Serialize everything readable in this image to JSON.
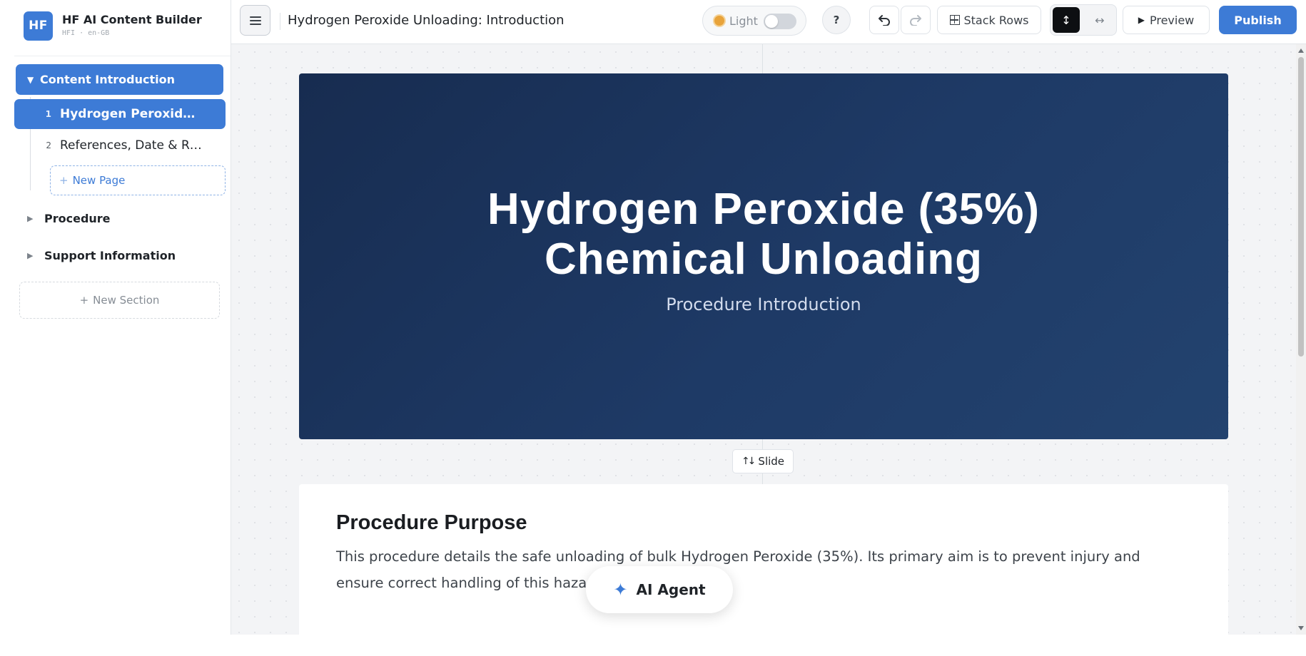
{
  "brand": {
    "logo_text": "HF",
    "title": "HF AI Content Builder",
    "subtitle": "HFI · en-GB",
    "accent_color": "#3d7bd6"
  },
  "sidebar": {
    "sections": [
      {
        "label": "Content Introduction",
        "expanded": true,
        "active": true,
        "pages": [
          {
            "number": "1",
            "label": "Hydrogen Peroxide ...",
            "active": true
          },
          {
            "number": "2",
            "label": "References, Date & Ri...",
            "active": false
          }
        ]
      },
      {
        "label": "Procedure",
        "expanded": false
      },
      {
        "label": "Support Information",
        "expanded": false
      }
    ],
    "new_page_label": "New Page",
    "new_section_label": "New Section",
    "icons": {
      "expanded": "caret-down-icon",
      "collapsed": "caret-right-icon",
      "add": "plus-icon"
    }
  },
  "toolbar": {
    "menu_icon": "hamburger-menu-icon",
    "document_title": "Hydrogen Peroxide Unloading: Introduction",
    "theme_label": "Light",
    "theme_dark_enabled": false,
    "help_label": "?",
    "undo_icon": "undo-icon",
    "redo_icon": "redo-icon",
    "stack_rows_label": "Stack Rows",
    "layout_mode": "vertical",
    "preview_label": "Preview",
    "publish_label": "Publish"
  },
  "canvas": {
    "title_slide": {
      "title": "Hydrogen Peroxide (35%)\nChemical Unloading",
      "subtitle": "Procedure Introduction",
      "background_color": "#1e3a66"
    },
    "slide_chip_label": "Slide",
    "content_block": {
      "heading": "Procedure Purpose",
      "body": "This procedure details the safe unloading of bulk Hydrogen Peroxide (35%). Its primary aim is to prevent injury and ensure correct handling of this hazardous ch"
    }
  },
  "ai_agent": {
    "label": "AI Agent",
    "icon": "sparkle-icon"
  }
}
